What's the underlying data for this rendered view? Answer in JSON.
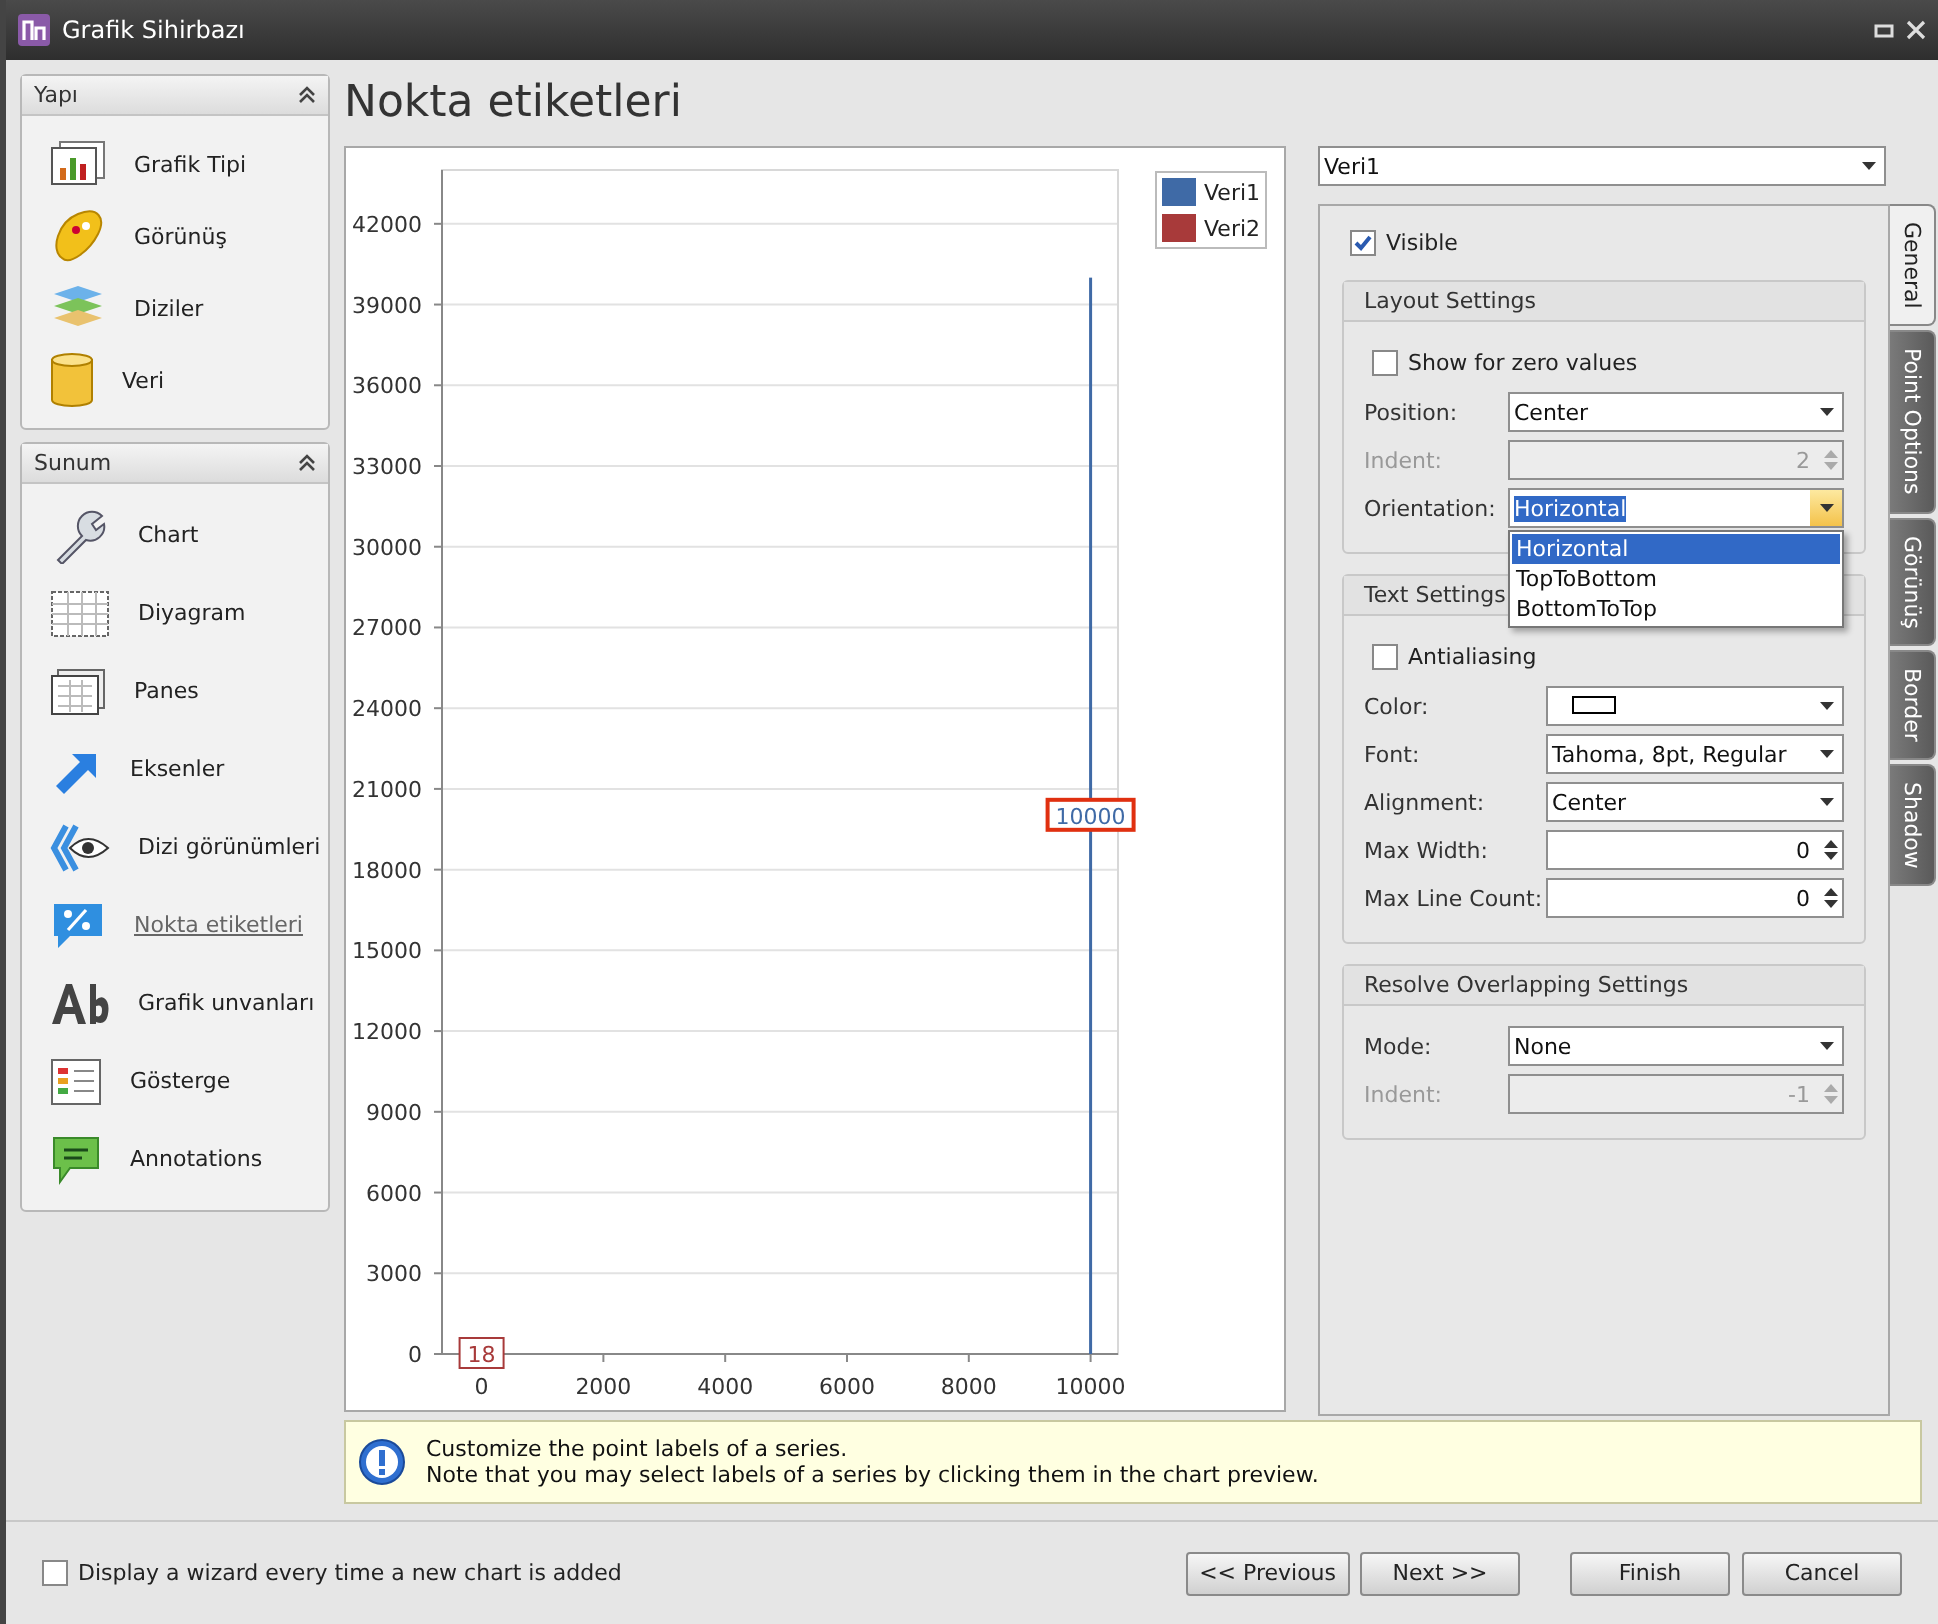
{
  "window": {
    "title": "Grafik Sihirbazı"
  },
  "sidebar": {
    "sections": [
      {
        "title": "Yapı",
        "expanded": true,
        "items": [
          {
            "label": "Grafik Tipi",
            "selected": false
          },
          {
            "label": "Görünüş",
            "selected": false
          },
          {
            "label": "Diziler",
            "selected": false
          },
          {
            "label": "Veri",
            "selected": false
          }
        ]
      },
      {
        "title": "Sunum",
        "expanded": true,
        "items": [
          {
            "label": "Chart",
            "selected": false
          },
          {
            "label": "Diyagram",
            "selected": false
          },
          {
            "label": "Panes",
            "selected": false
          },
          {
            "label": "Eksenler",
            "selected": false
          },
          {
            "label": "Dizi görünümleri",
            "selected": false
          },
          {
            "label": "Nokta etiketleri",
            "selected": true
          },
          {
            "label": "Grafik unvanları",
            "selected": false
          },
          {
            "label": "Gösterge",
            "selected": false
          },
          {
            "label": "Annotations",
            "selected": false
          }
        ]
      }
    ]
  },
  "page_title": "Nokta etiketleri",
  "chart": {
    "chart_data": {
      "type": "bar",
      "x": [
        0,
        10000
      ],
      "xlim": [
        -650,
        10450
      ],
      "ylim": [
        0,
        44000
      ],
      "xticks": [
        0,
        2000,
        4000,
        6000,
        8000,
        10000
      ],
      "yticks": [
        0,
        3000,
        6000,
        9000,
        12000,
        15000,
        18000,
        21000,
        24000,
        27000,
        30000,
        33000,
        36000,
        39000,
        42000
      ],
      "series": [
        {
          "name": "Veri1",
          "color": "#3f6aa6",
          "values": [
            null,
            40000
          ]
        },
        {
          "name": "Veri2",
          "color": "#a83a3a",
          "values": [
            18,
            null
          ]
        }
      ],
      "grid": true,
      "legend": true,
      "annotations": [
        {
          "text": "18",
          "x": 0,
          "y": 0
        },
        {
          "text": "10000",
          "x": 10000,
          "y": 20000
        }
      ]
    },
    "point_labels": [
      {
        "color": "#a83a3a",
        "selected": false
      },
      {
        "color": "#3f6aa6",
        "selected": true
      }
    ]
  },
  "series_select": {
    "value": "Veri1"
  },
  "tabs": [
    {
      "label": "General",
      "selected": true
    },
    {
      "label": "Point Options",
      "selected": false
    },
    {
      "label": "Görünüş",
      "selected": false
    },
    {
      "label": "Border",
      "selected": false
    },
    {
      "label": "Shadow",
      "selected": false
    }
  ],
  "visible": {
    "label": "Visible",
    "checked": true
  },
  "groups": [
    {
      "title": "Layout Settings",
      "rows": [
        {
          "kind": "checkbox",
          "label": "Show for zero values",
          "checked": false
        },
        {
          "kind": "combo",
          "label": "Position:",
          "value": "Center",
          "disabled": false
        },
        {
          "kind": "spin",
          "label": "Indent:",
          "value": "2",
          "disabled": true
        },
        {
          "kind": "combo",
          "label": "Orientation:",
          "value": "Horizontal",
          "disabled": false,
          "open": true,
          "options": [
            {
              "label": "Horizontal",
              "selected": true
            },
            {
              "label": "TopToBottom",
              "selected": false
            },
            {
              "label": "BottomToTop",
              "selected": false
            }
          ]
        }
      ]
    },
    {
      "title": "Text Settings",
      "rows": [
        {
          "kind": "checkbox",
          "label": "Antialiasing",
          "checked": false
        },
        {
          "kind": "color",
          "label": "Color:",
          "color": "#ffffff",
          "disabled": false
        },
        {
          "kind": "combo",
          "label": "Font:",
          "value": "Tahoma, 8pt, Regular",
          "disabled": false
        },
        {
          "kind": "combo",
          "label": "Alignment:",
          "value": "Center",
          "disabled": false
        },
        {
          "kind": "spin",
          "label": "Max Width:",
          "value": "0",
          "disabled": false
        },
        {
          "kind": "spin",
          "label": "Max Line Count:",
          "value": "0",
          "disabled": false
        }
      ]
    },
    {
      "title": "Resolve Overlapping Settings",
      "rows": [
        {
          "kind": "combo",
          "label": "Mode:",
          "value": "None",
          "disabled": false
        },
        {
          "kind": "spin",
          "label": "Indent:",
          "value": "-1",
          "disabled": true
        }
      ]
    }
  ],
  "info": {
    "lines": [
      "Customize the point labels of a series.",
      "Note that you may select labels of a series by clicking them in the chart preview."
    ]
  },
  "footer": {
    "checkbox": {
      "label": "Display a wizard every time a new chart is added",
      "checked": false
    },
    "buttons": [
      {
        "label": "<< Previous"
      },
      {
        "label": "Next >>"
      },
      {
        "label": "Finish"
      },
      {
        "label": "Cancel"
      }
    ]
  }
}
